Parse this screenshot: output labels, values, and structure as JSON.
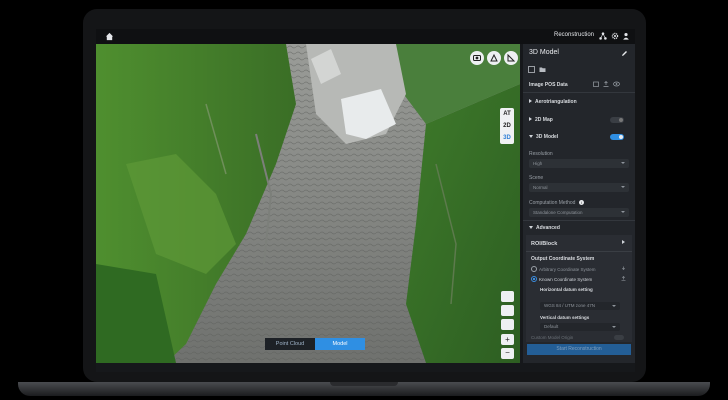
{
  "app": {
    "section_title": "Reconstruction"
  },
  "icons": {
    "home": "home-icon",
    "nodes": "network-icon",
    "settings": "gear-icon",
    "user": "user-icon",
    "camera": "camera-icon",
    "area": "area-select-icon",
    "measure": "measure-icon"
  },
  "view_modes": {
    "at": "AT",
    "two_d": "2D",
    "three_d": "3D",
    "active": "3D"
  },
  "map_tabs": {
    "point_cloud": "Point Cloud",
    "model": "Model"
  },
  "panel": {
    "title": "3D Model",
    "image_pos": "Image POS Data",
    "aerotriangulation": "Aerotriangulation",
    "map2d": "2D Map",
    "model3d": "3D Model",
    "map2d_enabled": false,
    "model3d_enabled": true,
    "resolution_label": "Resolution",
    "resolution_value": "High",
    "scene_label": "Scene",
    "scene_value": "Normal",
    "computation_label": "Computation Method",
    "computation_value": "Standalone Computation",
    "advanced": "Advanced",
    "roi_block": "ROI/Block",
    "output_cs": "Output Coordinate System",
    "arbitrary_cs": "Arbitrary Coordinate System",
    "known_cs": "Known Coordinate System",
    "horizontal_label": "Horizontal datum setting",
    "horizontal_value": "WGS 84 / UTM zone 47N",
    "vertical_label": "Vertical datum settings",
    "vertical_value": "Default",
    "custom_origin": "Custom Model Origin",
    "start_button": "Start Reconstruction"
  },
  "colors": {
    "accent": "#2f8fe3",
    "panel_bg": "#23262b",
    "terrain_green": "#3f7d2a",
    "terrain_gray": "#8a8d8a"
  }
}
